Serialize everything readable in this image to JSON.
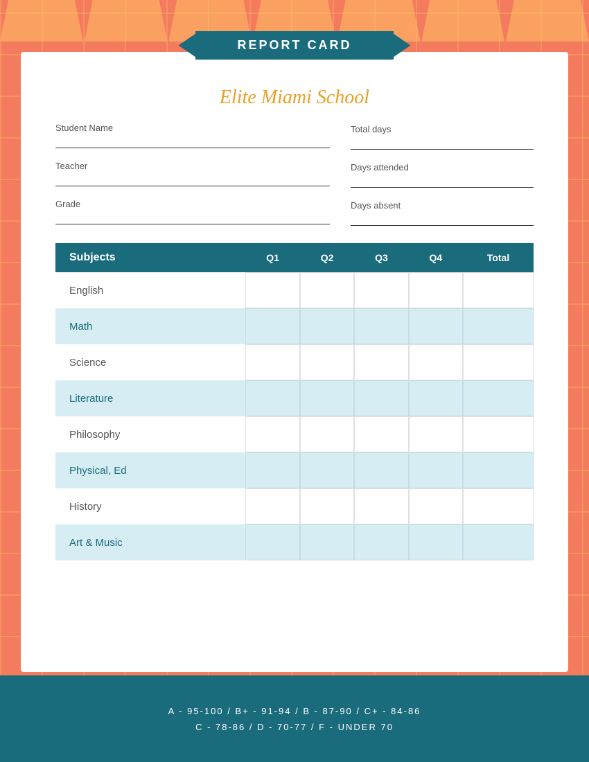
{
  "page": {
    "background_color": "#f47b5e"
  },
  "banner": {
    "label": "REPORT CARD"
  },
  "school": {
    "name": "Elite Miami School"
  },
  "fields": {
    "student_name_label": "Student Name",
    "teacher_label": "Teacher",
    "grade_label": "Grade",
    "total_days_label": "Total days",
    "days_attended_label": "Days attended",
    "days_absent_label": "Days absent"
  },
  "table": {
    "headers": {
      "subjects": "Subjects",
      "q1": "Q1",
      "q2": "Q2",
      "q3": "Q3",
      "q4": "Q4",
      "total": "Total"
    },
    "rows": [
      {
        "subject": "English",
        "style": "white"
      },
      {
        "subject": "Math",
        "style": "blue"
      },
      {
        "subject": "Science",
        "style": "white"
      },
      {
        "subject": "Literature",
        "style": "blue"
      },
      {
        "subject": "Philosophy",
        "style": "white"
      },
      {
        "subject": "Physical, Ed",
        "style": "blue"
      },
      {
        "subject": "History",
        "style": "white"
      },
      {
        "subject": "Art & Music",
        "style": "blue"
      }
    ]
  },
  "grading_scale": {
    "line1": "A - 95-100  /  B+ - 91-94  /  B - 87-90  /  C+ - 84-86",
    "line2": "C - 78-86  /  D - 70-77  /  F - UNDER 70"
  }
}
